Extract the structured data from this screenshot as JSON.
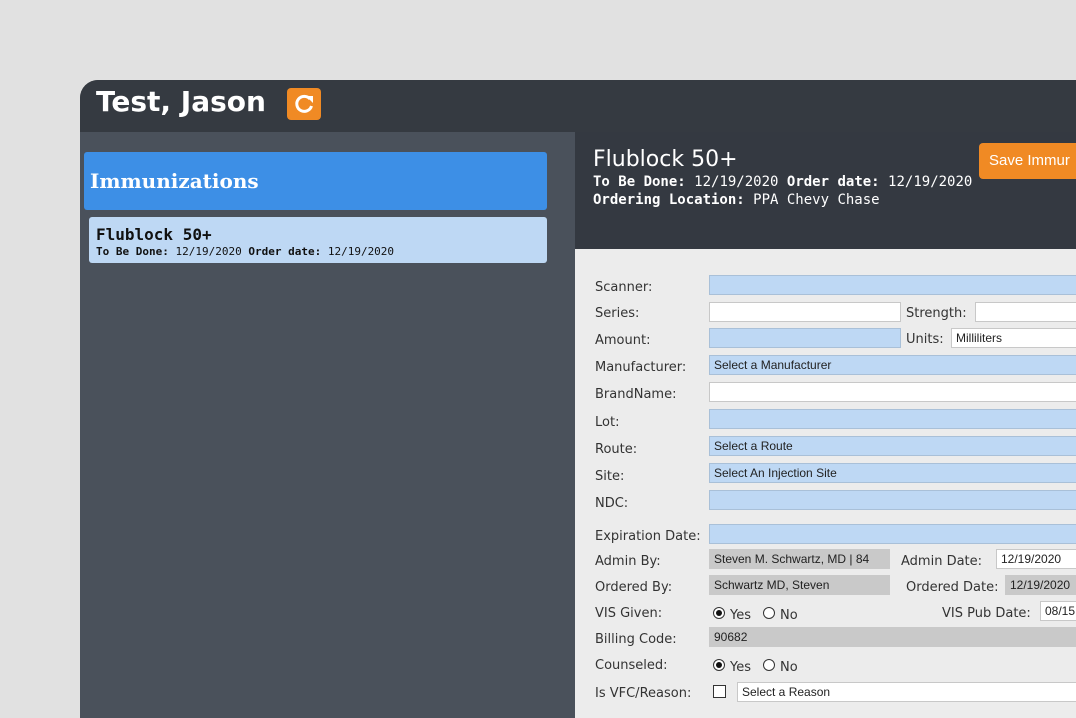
{
  "patient": {
    "name": "Test, Jason"
  },
  "sidebar": {
    "header": "Immunizations",
    "items": [
      {
        "title": "Flublock 50+",
        "to_be_done_label": "To Be Done:",
        "to_be_done": "12/19/2020",
        "order_date_label": "Order date:",
        "order_date": "12/19/2020"
      }
    ]
  },
  "detail": {
    "title": "Flublock 50+",
    "to_be_done_label": "To Be Done:",
    "to_be_done": "12/19/2020",
    "order_date_label": "Order date:",
    "order_date": "12/19/2020",
    "location_label": "Ordering Location:",
    "location": "PPA Chevy Chase",
    "save_label": "Save Immur"
  },
  "form": {
    "scanner_label": "Scanner:",
    "series_label": "Series:",
    "strength_label": "Strength:",
    "amount_label": "Amount:",
    "units_label": "Units:",
    "units_value": "Milliliters",
    "manufacturer_label": "Manufacturer:",
    "manufacturer_value": "Select a Manufacturer",
    "brandname_label": "BrandName:",
    "lot_label": "Lot:",
    "route_label": "Route:",
    "route_value": "Select a Route",
    "site_label": "Site:",
    "site_value": "Select An Injection Site",
    "ndc_label": "NDC:",
    "expiration_label": "Expiration Date:",
    "admin_by_label": "Admin By:",
    "admin_by_value": "Steven M. Schwartz, MD | 84",
    "admin_date_label": "Admin Date:",
    "admin_date_value": "12/19/2020",
    "ordered_by_label": "Ordered By:",
    "ordered_by_value": "Schwartz MD, Steven",
    "ordered_date_label": "Ordered Date:",
    "ordered_date_value": "12/19/2020",
    "vis_given_label": "VIS Given:",
    "yes_label": "Yes",
    "no_label": "No",
    "vis_pub_label": "VIS Pub Date:",
    "vis_pub_value": "08/15",
    "billing_label": "Billing Code:",
    "billing_value": "90682",
    "counseled_label": "Counseled:",
    "vfc_label": "Is VFC/Reason:",
    "vfc_reason_value": "Select a Reason"
  },
  "colors": {
    "accent": "#f08a24",
    "header_blue": "#3d8fe6",
    "field_blue": "#bed8f4"
  },
  "icons": {
    "refresh": "refresh-icon"
  }
}
